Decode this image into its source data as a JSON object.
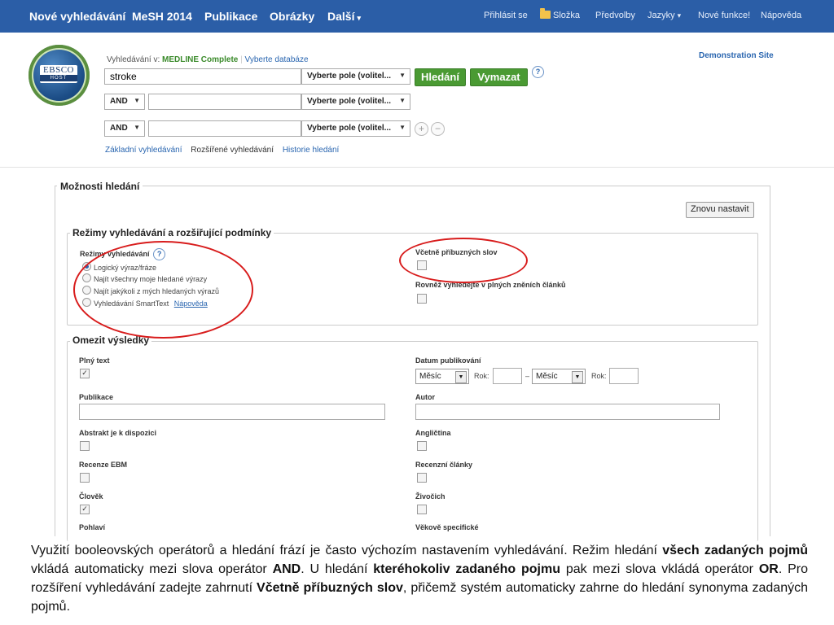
{
  "topnav": {
    "left": [
      "Nové vyhledávání",
      "MeSH 2014",
      "Publikace",
      "Obrázky",
      "Další"
    ],
    "more_caret": "▾",
    "right": [
      "Přihlásit se",
      "Složka",
      "Předvolby",
      "Jazyky",
      "Nové funkce!",
      "Nápověda"
    ]
  },
  "logo": {
    "top": "EBSCO",
    "bottom": "HOST"
  },
  "demo_site": "Demonstration Site",
  "search": {
    "db_prefix": "Vyhledávání v:",
    "db_name": "MEDLINE Complete",
    "db_choose": "Vyberte databáze",
    "query1": "stroke",
    "field_select": "Vyberte pole (volitel...",
    "operator": "AND",
    "search_btn": "Hledání",
    "clear_btn": "Vymazat",
    "help": "?",
    "plus": "+",
    "minus": "−",
    "links": [
      "Základní vyhledávání",
      "Rozšířené vyhledávání",
      "Historie hledání"
    ]
  },
  "options": {
    "title": "Možnosti hledání",
    "reset": "Znovu nastavit",
    "modes_title": "Režimy vyhledávání a rozšiřující podmínky",
    "modes_label": "Režimy vyhledávání",
    "modes": [
      "Logický výraz/fráze",
      "Najít všechny moje hledané výrazy",
      "Najít jakýkoli z mých hledaných výrazů",
      "Vyhledávání SmartText"
    ],
    "modes_help_link": "Nápověda",
    "related": "Včetně příbuzných slov",
    "fulltext_search": "Rovněž vyhledejte v plných zněních článků",
    "limit_title": "Omezit výsledky",
    "fulltext": "Plný text",
    "pubdate": "Datum publikování",
    "month": "Měsíc",
    "year": "Rok:",
    "dash": "–",
    "publication": "Publikace",
    "author": "Autor",
    "abstract": "Abstrakt je k dispozici",
    "english": "Angličtina",
    "ebm": "Recenze EBM",
    "review": "Recenzní články",
    "human": "Člověk",
    "animal": "Živočich",
    "sex": "Pohlaví",
    "age": "Věkově specifické",
    "check": "✓"
  },
  "caption": {
    "p1": "Využití booleovských operátorů a hledání frází je často výchozím nastavením vyhledávání. Režim hledání ",
    "b1": "všech zadaných pojmů",
    "p2": " vkládá automaticky mezi slova operátor ",
    "b2": "AND",
    "p3": ". U hledání ",
    "b3": "kteréhokoliv zadaného pojmu",
    "p4": " pak mezi slova vkládá operátor ",
    "b4": "OR",
    "p5": ". Pro rozšíření vyhledávání zadejte zahrnutí ",
    "b5": "Včetně příbuzných slov",
    "p6": ", přičemž systém automaticky zahrne do hledání synonyma zadaných pojmů."
  },
  "colors": {
    "nav": "#2b5ea7",
    "green": "#4a9a33",
    "annotation": "#d81c1c"
  }
}
